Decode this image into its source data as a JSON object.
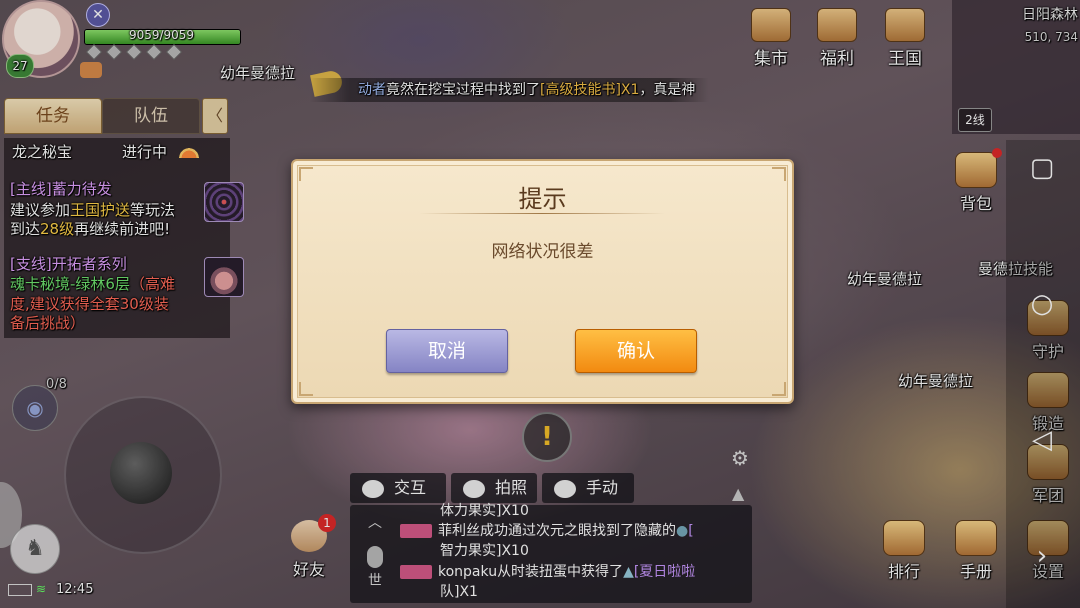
{
  "player": {
    "level": "27",
    "hp_text": "9059/9059",
    "hp_fraction": 1.0
  },
  "npc_labels": [
    "幼年曼德拉",
    "幼年曼德拉",
    "幼年曼德拉",
    "曼德拉技能"
  ],
  "broadcast": {
    "prefix": "动者",
    "text": "竟然在挖宝过程中找到了",
    "item": "[高级技能书]X1",
    "suffix": "，真是神"
  },
  "top_menu": {
    "market": "集市",
    "welfare": "福利",
    "kingdom": "王国"
  },
  "minimap": {
    "map_name": "日阳森林",
    "coords": "510, 734",
    "line": "2线"
  },
  "tabs": {
    "quest": "任务",
    "team": "队伍",
    "collapse": "〈"
  },
  "quest": {
    "title": "龙之秘宝",
    "status": "进行中",
    "main_tag": "[主线]",
    "main_name": "蓄力待发",
    "main_desc_1": "建议参加",
    "main_desc_highlight": "王国护送",
    "main_desc_2": "等玩法",
    "main_desc_3": "到达",
    "main_desc_level": "28级",
    "main_desc_4": "再继续前进吧!",
    "side_tag": "[支线]",
    "side_name": "开拓者系列",
    "side_loc": "魂卡秘境-绿林6层",
    "side_warn_1": "（高难",
    "side_warn_2": "度,建议获得全套30级装",
    "side_warn_3": "备后挑战）"
  },
  "hud": {
    "eye_count": "0/8",
    "time": "12:45"
  },
  "actions": {
    "interact": "交互",
    "photo": "拍照",
    "manual": "手动"
  },
  "chat": {
    "channel": "世",
    "lines": [
      "体力果实]X10",
      "菲利丝成功通过次元之眼找到了隐藏的",
      "[",
      "智力果实]X10",
      "konpaku从时装扭蛋中获得了",
      "[夏日啦啦",
      "队]X1"
    ]
  },
  "friend": {
    "label": "好友",
    "badge": "1"
  },
  "right_menu": {
    "bag": "背包",
    "guard": "守护",
    "forge": "锻造",
    "legion": "军团",
    "rank": "排行",
    "handbook": "手册",
    "settings": "设置"
  },
  "dialog": {
    "title": "提示",
    "message": "网络状况很差",
    "cancel": "取消",
    "confirm": "确认"
  }
}
